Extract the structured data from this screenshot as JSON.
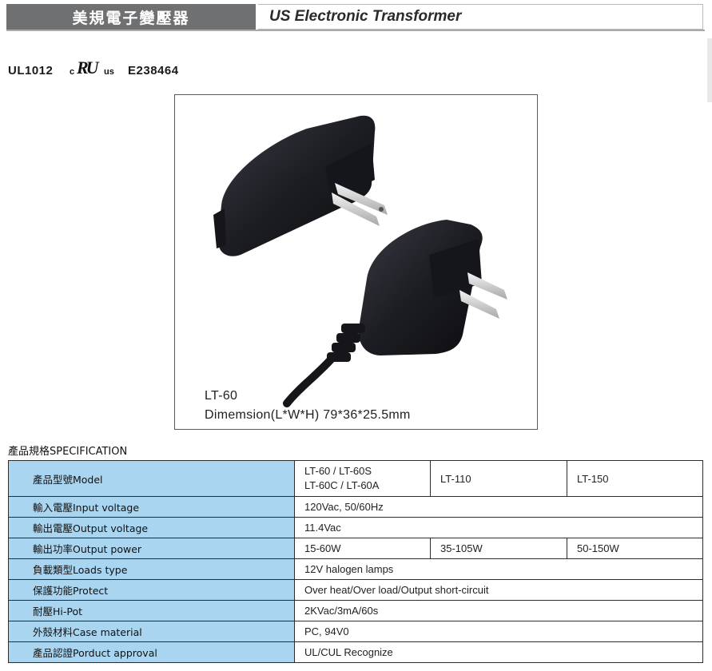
{
  "header": {
    "title_cn": "美規電子變壓器",
    "title_en": "US Electronic Transformer"
  },
  "certification": {
    "standard": "UL1012",
    "mark": "cRUus",
    "mark_c": "c",
    "mark_ru": "RU",
    "mark_us": "us",
    "file_number": "E238464"
  },
  "photo": {
    "model_caption": "LT-60",
    "dimension_caption": "Dimemsion(L*W*H)  79*36*25.5mm"
  },
  "spec": {
    "title": "產品規格SPECIFICATION",
    "rows": [
      {
        "label": "產品型號Model",
        "values": [
          "LT-60 / LT-60S",
          "LT-60C / LT-60A",
          "LT-110",
          "LT-150"
        ]
      },
      {
        "label": "輸入電壓Input voltage",
        "values": [
          "120Vac, 50/60Hz"
        ]
      },
      {
        "label": "輸出電壓Output voltage",
        "values": [
          "11.4Vac"
        ]
      },
      {
        "label": "輸出功率Output power",
        "values": [
          "15-60W",
          "35-105W",
          "50-150W"
        ]
      },
      {
        "label": "負載類型Loads type",
        "values": [
          "12V halogen lamps"
        ]
      },
      {
        "label": "保護功能Protect",
        "values": [
          "Over heat/Over load/Output short-circuit"
        ]
      },
      {
        "label": "耐壓Hi-Pot",
        "values": [
          "2KVac/3mA/60s"
        ]
      },
      {
        "label": "外殼材料Case material",
        "values": [
          "PC, 94V0"
        ]
      },
      {
        "label": "產品認證Porduct approval",
        "values": [
          "UL/CUL Recognize"
        ]
      }
    ]
  },
  "colors": {
    "header_band": "#6f7072",
    "label_cell": "#a9d5f0",
    "adapter_body": "#1c1d22"
  }
}
